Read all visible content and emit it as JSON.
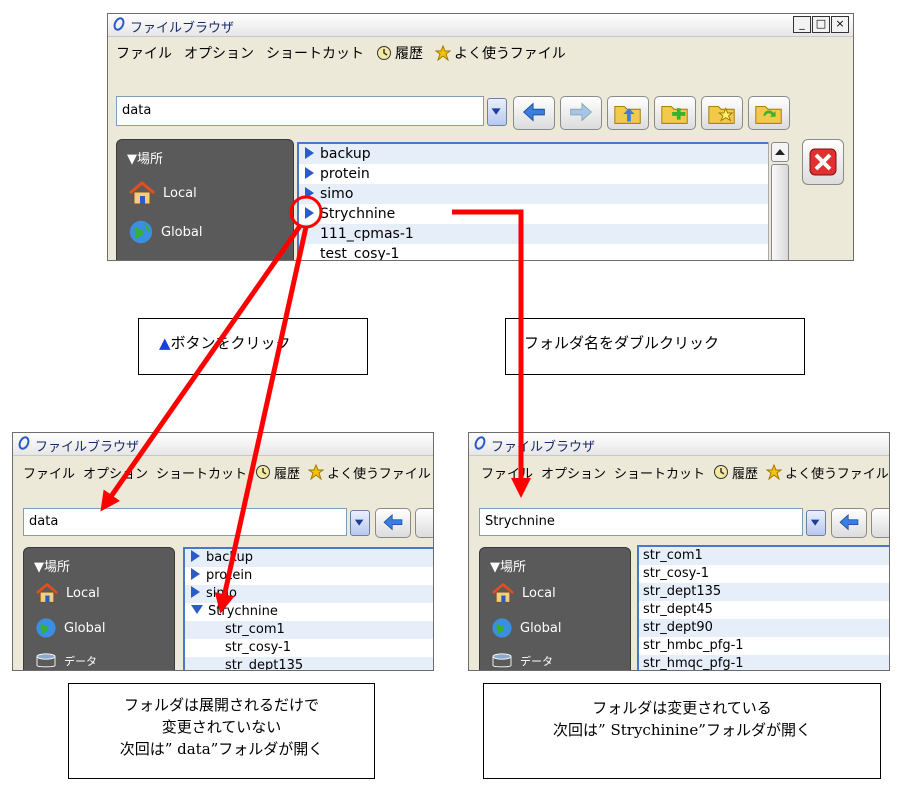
{
  "window": {
    "title": "ファイルブラウザ",
    "minimize": "_",
    "maximize": "□",
    "close": "×"
  },
  "menu": {
    "file": "ファイル",
    "options": "オプション",
    "shortcut": "ショートカット",
    "history": "履歴",
    "favorites": "よく使うファイル",
    "favorites_clipped": "よく使うファイル"
  },
  "sidebar": {
    "header": "▼場所",
    "local": "Local",
    "global": "Global",
    "data": "データ"
  },
  "top_panel": {
    "address": "data",
    "files": [
      "backup",
      "protein",
      "simo",
      "Strychnine",
      "111_cpmas-1",
      "test_cosy-1"
    ]
  },
  "left_panel": {
    "address": "data",
    "folders": [
      "backup",
      "protein",
      "simo"
    ],
    "expanded_folder": "Strychnine",
    "children": [
      "str_com1",
      "str_cosy-1",
      "str_dept135"
    ]
  },
  "right_panel": {
    "address": "Strychnine",
    "files": [
      "str_com1",
      "str_cosy-1",
      "str_dept135",
      "str_dept45",
      "str_dept90",
      "str_hmbc_pfg-1",
      "str_hmqc_pfg-1"
    ]
  },
  "callouts": {
    "click_button": "ボタンをクリック",
    "click_marker": "▲",
    "double_click": "フォルダ名をダブルクリック",
    "left_note_1": "フォルダは展開されるだけで",
    "left_note_2": "変更されていない",
    "left_note_3": "次回は” data”フォルダが開く",
    "right_note_1": "フォルダは変更されている",
    "right_note_2": "次回は” Strychinine”フォルダが開く"
  },
  "colors": {
    "arrow": "#ff0000",
    "accent": "#2a5cc8",
    "sidebar": "#5a5a5a"
  }
}
